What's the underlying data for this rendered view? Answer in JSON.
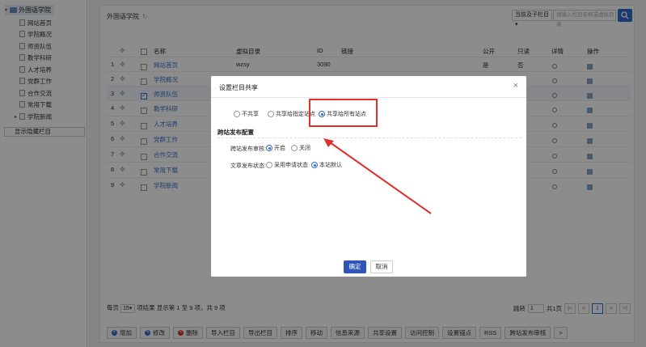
{
  "sidebar": {
    "root_label": "外国语学院",
    "items": [
      "网站首页",
      "学院概况",
      "师资队伍",
      "教学科研",
      "人才培养",
      "党群工作",
      "合作交流",
      "常用下载",
      "学院新闻"
    ],
    "show_hidden": "显示隐藏栏目"
  },
  "header": {
    "breadcrumb": "外国语学院",
    "scope_select": "当前及子栏目",
    "search_placeholder": "请输入栏目名称或虚拟目录"
  },
  "table": {
    "columns": [
      "名称",
      "虚拟目录",
      "ID",
      "链接",
      "公开",
      "只读",
      "详情",
      "操作"
    ],
    "rows": [
      {
        "num": "1",
        "name": "网站首页",
        "vdir": "wzsy",
        "id": "3090",
        "public": "是",
        "readonly": "否"
      },
      {
        "num": "2",
        "name": "学院概况"
      },
      {
        "num": "3",
        "name": "师资队伍",
        "checked": true
      },
      {
        "num": "4",
        "name": "教学科研"
      },
      {
        "num": "5",
        "name": "人才培养"
      },
      {
        "num": "6",
        "name": "党群工作"
      },
      {
        "num": "7",
        "name": "合作交流"
      },
      {
        "num": "8",
        "name": "常用下载"
      },
      {
        "num": "9",
        "name": "学院新闻"
      }
    ]
  },
  "pagination": {
    "per_page_label": "每页",
    "per_page": "15",
    "summary": "项结果 显示第 1 至 9 项，共 9 项",
    "jump_label": "跳转",
    "jump_value": "1",
    "total_pages": "共1页",
    "current_page": "1",
    "first": "|<",
    "prev": "<",
    "next": ">",
    "last": ">|"
  },
  "toolbar": [
    "增加",
    "修改",
    "删除",
    "导入栏目",
    "导出栏目",
    "排序",
    "移动",
    "信息来源",
    "共享设置",
    "访问控制",
    "设置锚点",
    "RSS",
    "跨站发布审核",
    ">"
  ],
  "modal": {
    "title": "设置栏目共享",
    "share_options": [
      "不共享",
      "共享给指定站点",
      "共享给所有站点"
    ],
    "section_title": "跨站发布配置",
    "audit_label": "跨站发布审核:",
    "audit_options": [
      "开启",
      "关闭"
    ],
    "status_label": "文章发布状态:",
    "status_options": [
      "采用申请状态",
      "本站默认"
    ],
    "ok": "确定",
    "cancel": "取消"
  },
  "colors": {
    "accent": "#2f55b8",
    "highlight": "#e0302a"
  }
}
